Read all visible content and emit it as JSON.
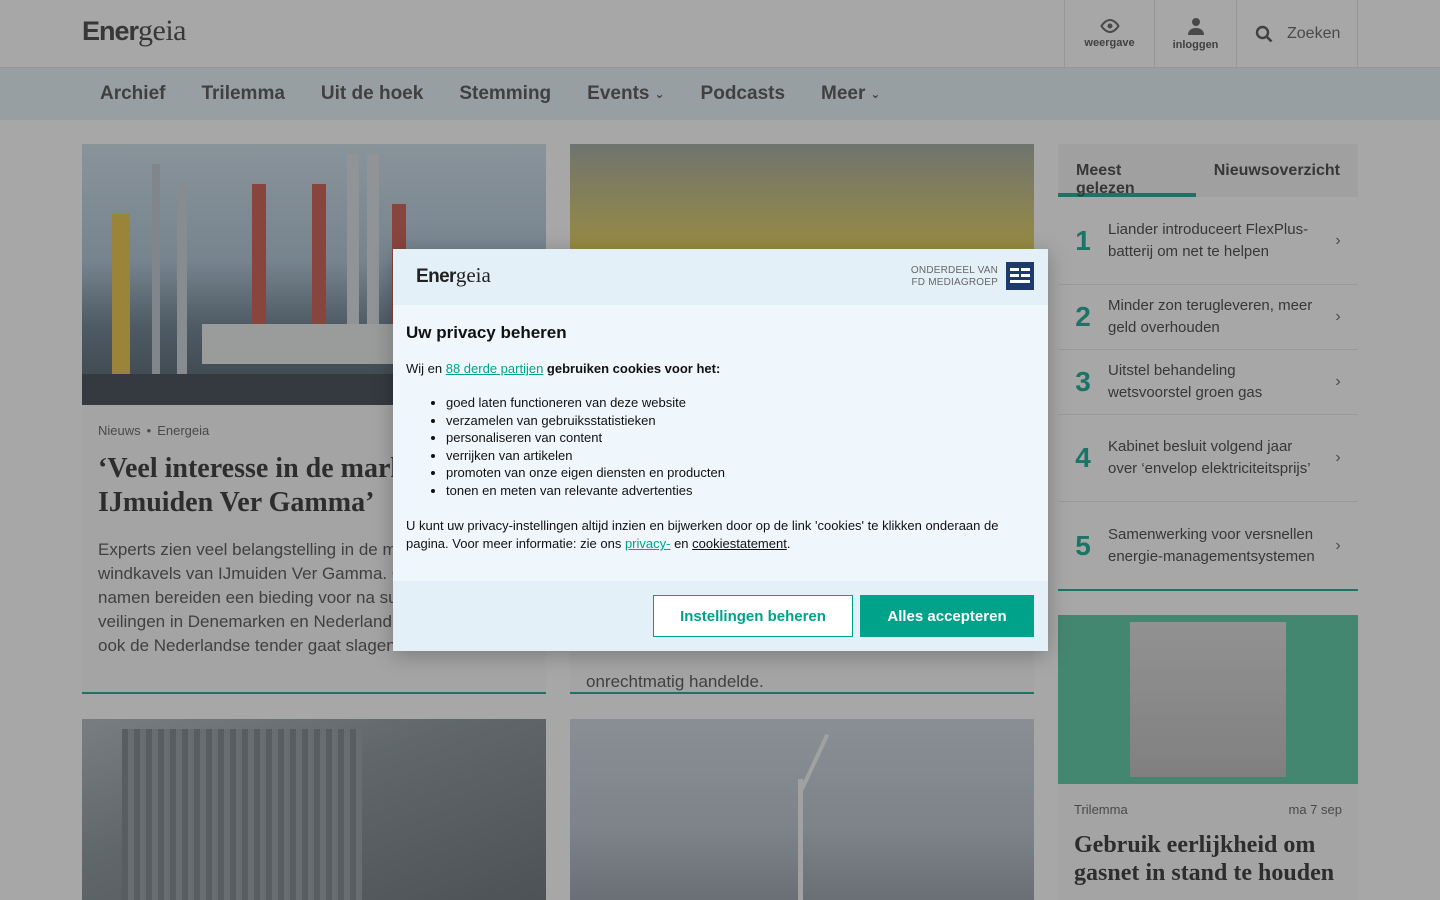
{
  "header": {
    "logo_prefix": "Ener",
    "logo_suffix": "geia",
    "view_label": "weergave",
    "login_label": "inloggen",
    "search_label": "Zoeken"
  },
  "nav": {
    "items": [
      {
        "label": "Archief"
      },
      {
        "label": "Trilemma"
      },
      {
        "label": "Uit de hoek"
      },
      {
        "label": "Stemming"
      },
      {
        "label": "Events",
        "dropdown": true
      },
      {
        "label": "Podcasts"
      },
      {
        "label": "Meer",
        "dropdown": true
      }
    ]
  },
  "articles": [
    {
      "category": "Nieuws",
      "source": "Energeia",
      "title": "‘Veel interesse in de markt voor IJmuiden Ver Gamma’",
      "body": "Experts zien veel belangstelling in de markt voor offshore windkavels van IJmuiden Ver Gamma. Gevestigde namen bereiden een bieding voor na succesvolle veilingen in Denemarken en Nederland, kans groot dat ook de Nederlandse tender gaat slagen."
    },
    {
      "body_tail": "onrechtmatig handelde."
    }
  ],
  "sidebar": {
    "tab_most_read": "Meest gelezen",
    "tab_overview": "Nieuwsoverzicht",
    "most_read": [
      {
        "rank": "1",
        "title": "Liander introduceert FlexPlus-batterij om net te helpen"
      },
      {
        "rank": "2",
        "title": "Minder zon terugleveren, meer geld overhouden"
      },
      {
        "rank": "3",
        "title": "Uitstel behandeling wetsvoorstel groen gas"
      },
      {
        "rank": "4",
        "title": "Kabinet besluit volgend jaar over ‘envelop elektriciteitsprijs’"
      },
      {
        "rank": "5",
        "title": "Samenwerking voor versnellen energie-managementsystemen"
      }
    ],
    "promo": {
      "category": "Trilemma",
      "date": "ma 7 sep",
      "title": "Gebruik eerlijkheid om gasnet in stand te houden"
    }
  },
  "modal": {
    "logo_prefix": "Ener",
    "logo_suffix": "geia",
    "fd_line1": "ONDERDEEL VAN",
    "fd_line2": "FD MEDIAGROEP",
    "title": "Uw privacy beheren",
    "intro_prefix": "Wij en ",
    "intro_link": "88 derde partijen",
    "intro_suffix": " gebruiken cookies voor het:",
    "purposes": [
      "goed laten functioneren van deze website",
      "verzamelen van gebruiksstatistieken",
      "personaliseren van content",
      "verrijken van artikelen",
      "promoten van onze eigen diensten en producten",
      "tonen en meten van relevante advertenties"
    ],
    "outro_text": "U kunt uw privacy-instellingen altijd inzien en bijwerken door op de link 'cookies' te klikken onderaan de pagina. Voor meer informatie: zie ons ",
    "privacy_link": "privacy-",
    "outro_and": " en ",
    "cookie_link": "cookiestatement",
    "outro_end": ".",
    "btn_settings": "Instellingen beheren",
    "btn_accept": "Alles accepteren"
  },
  "colors": {
    "accent": "#00a389",
    "nav_bg": "#e4f1f8",
    "fd_blue": "#1d3a6e"
  }
}
